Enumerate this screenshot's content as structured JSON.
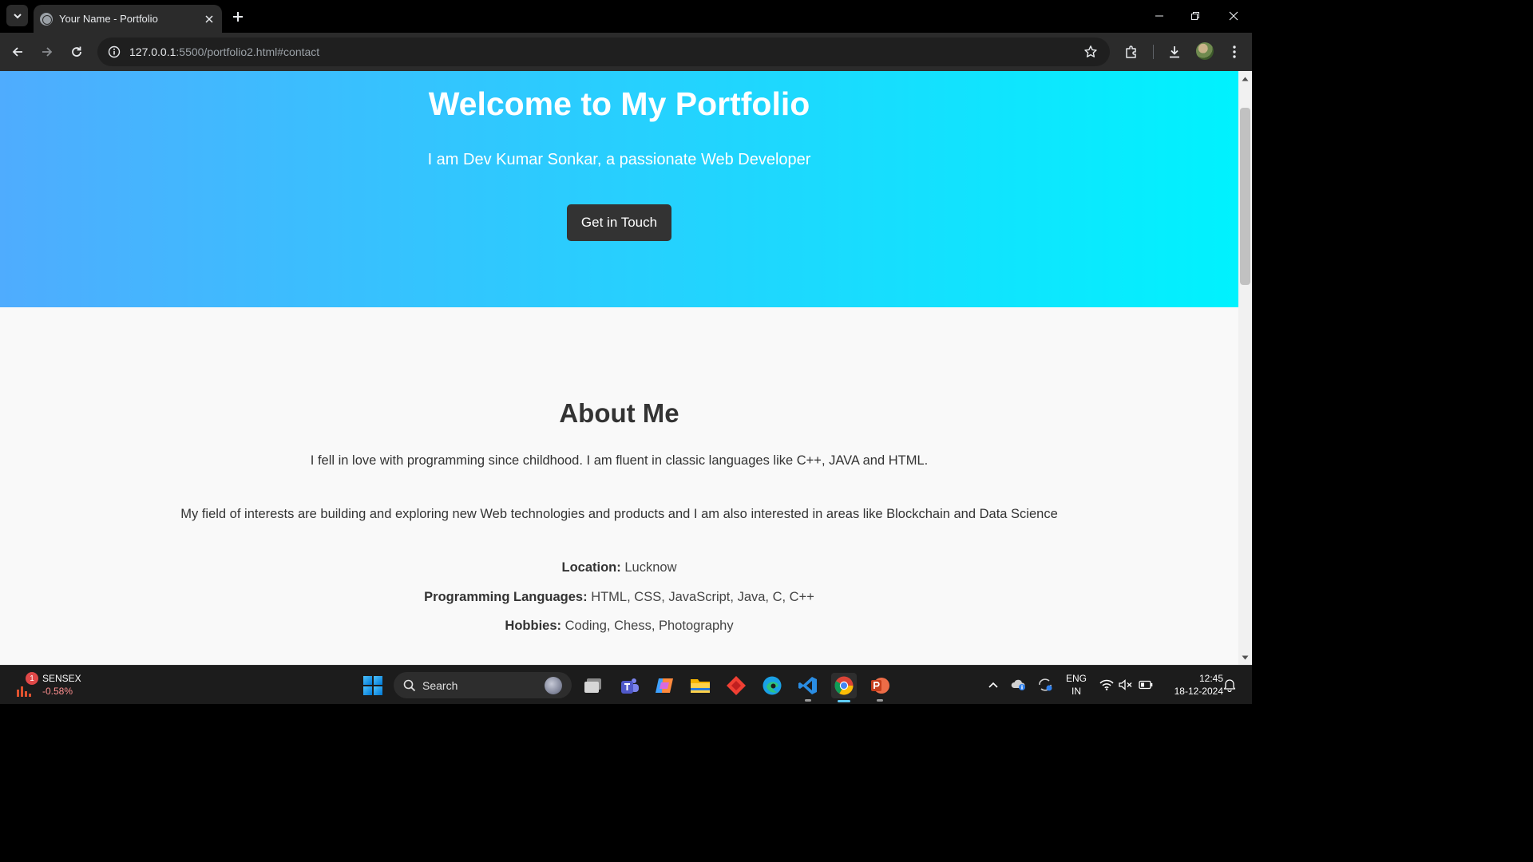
{
  "browser": {
    "tab_title": "Your Name - Portfolio",
    "url_host": "127.0.0.1",
    "url_path": ":5500/portfolio2.html#contact"
  },
  "hero": {
    "title": "Welcome to My Portfolio",
    "subtitle": "I am Dev Kumar Sonkar, a passionate Web Developer",
    "cta_label": "Get in Touch",
    "gradient_start": "#4facfe",
    "gradient_end": "#00f2fe"
  },
  "about": {
    "heading": "About Me",
    "paragraph1": "I fell in love with programming since childhood. I am fluent in classic languages like C++, JAVA and HTML.",
    "paragraph2": "My field of interests are building and exploring new Web technologies and products and I am also interested in areas like Blockchain and Data Science",
    "location_label": "Location:",
    "location_value": "Lucknow",
    "languages_label": "Programming Languages:",
    "languages_value": "HTML, CSS, JavaScript, Java, C, C++",
    "hobbies_label": "Hobbies:",
    "hobbies_value": "Coding, Chess, Photography"
  },
  "taskbar": {
    "widget_badge": "1",
    "widget_title": "SENSEX",
    "widget_value": "-0.58%",
    "search_label": "Search",
    "lang_line1": "ENG",
    "lang_line2": "IN",
    "time": "12:45",
    "date": "18-12-2024"
  }
}
